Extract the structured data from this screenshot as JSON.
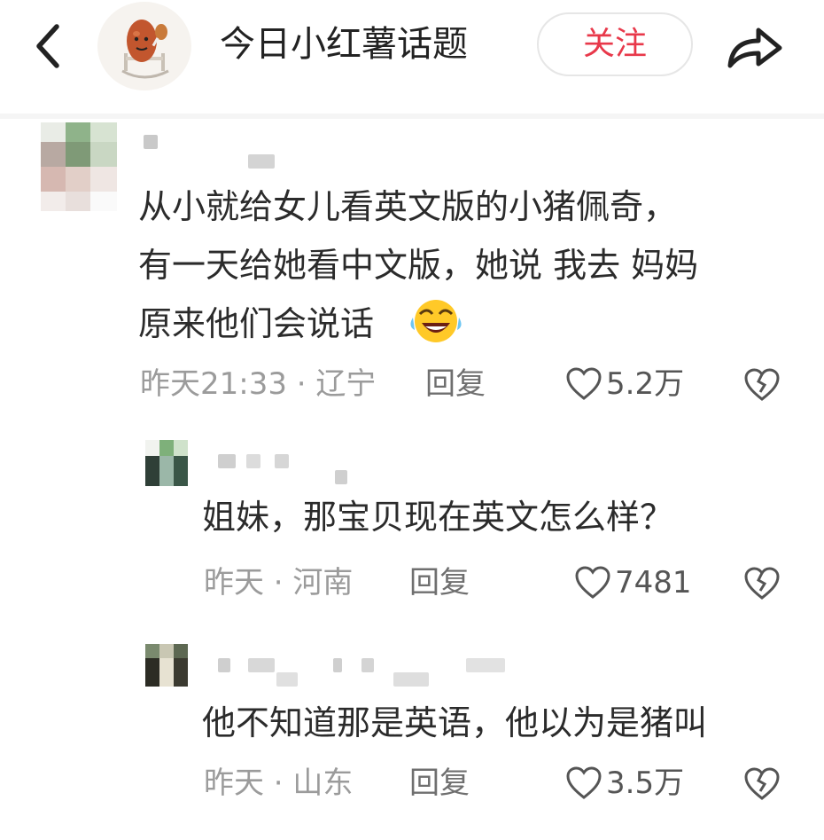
{
  "header": {
    "account_name": "今日小红薯话题",
    "follow_label": "关注",
    "back_icon": "chevron-left-icon",
    "share_icon": "share-arrow-icon"
  },
  "comments": [
    {
      "text_lines": [
        "从小就给女儿看英文版的小猪佩奇，",
        "有一天给她看中文版，她说 我去 妈妈",
        "原来他们会说话"
      ],
      "emoji": "laughing-crying-emoji",
      "time_location": "昨天21:33 · 辽宁",
      "reply_label": "回复",
      "likes": "5.2万"
    },
    {
      "text_lines": [
        "姐妹，那宝贝现在英文怎么样？"
      ],
      "time_location": "昨天 · 河南",
      "reply_label": "回复",
      "likes": "7481"
    },
    {
      "text_lines": [
        "他不知道那是英语，他以为是猪叫"
      ],
      "time_location": "昨天 · 山东",
      "reply_label": "回复",
      "likes": "3.5万"
    }
  ],
  "colors": {
    "accent": "#e8384a",
    "meta": "#9b9b9b",
    "text": "#2b2b2b"
  }
}
